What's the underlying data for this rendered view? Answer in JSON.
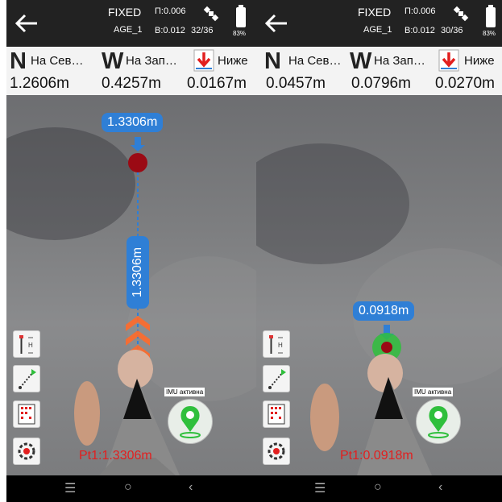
{
  "screens": [
    {
      "status": {
        "fix": "FIXED",
        "age": "AGE_1",
        "p": "П:0.006",
        "b": "B:0.012",
        "sats": "32/36",
        "battery": "83%"
      },
      "info": {
        "n_letter": "N",
        "n_label": "На Сев…",
        "w_letter": "W",
        "w_label": "На Зап…",
        "v_label": "Ниже",
        "n_val": "1.2606m",
        "w_val": "0.4257m",
        "v_val": "0.0167m"
      },
      "distance_top": "1.3306m",
      "distance_vertical": "1.3306m",
      "imu": "IMU активна",
      "point": "Pt1:1.3306m"
    },
    {
      "status": {
        "fix": "FIXED",
        "age": "AGE_1",
        "p": "П:0.006",
        "b": "B:0.012",
        "sats": "30/36",
        "battery": "83%"
      },
      "info": {
        "n_letter": "N",
        "n_label": "На Сев…",
        "w_letter": "W",
        "w_label": "На Зап…",
        "v_label": "Ниже",
        "n_val": "0.0457m",
        "w_val": "0.0796m",
        "v_val": "0.0270m"
      },
      "distance_top": "0.0918m",
      "imu": "IMU активна",
      "point": "Pt1:0.0918m"
    }
  ],
  "nav": {
    "recent": "☰",
    "home": "○",
    "back": "‹"
  },
  "colors": {
    "accent": "#2f7fd6",
    "target": "#9b0a14",
    "target_near": "#2fbf3c",
    "chevron": "#ff6a2a",
    "point_text": "#e21f1f"
  }
}
